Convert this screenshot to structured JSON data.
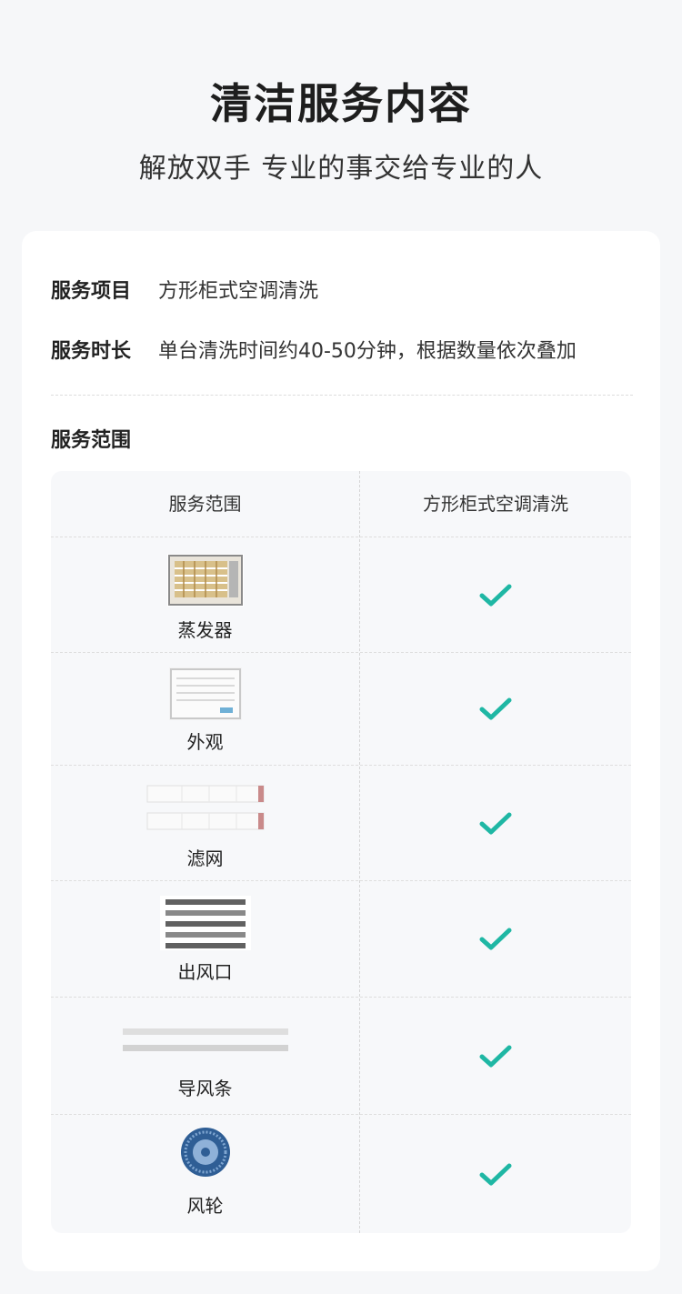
{
  "header": {
    "title": "清洁服务内容",
    "subtitle": "解放双手 专业的事交给专业的人"
  },
  "info": {
    "service_item_key": "服务项目",
    "service_item_value": "方形柜式空调清洗",
    "duration_key": "服务时长",
    "duration_value": "单台清洗时间约40-50分钟，根据数量依次叠加"
  },
  "scope": {
    "section_label": "服务范围",
    "col_left": "服务范围",
    "col_right": "方形柜式空调清洗",
    "rows": [
      {
        "label": "蒸发器",
        "icon": "evaporator-image",
        "included": true
      },
      {
        "label": "外观",
        "icon": "cabinet-exterior-image",
        "included": true
      },
      {
        "label": "滤网",
        "icon": "filter-image",
        "included": true
      },
      {
        "label": "出风口",
        "icon": "air-outlet-image",
        "included": true
      },
      {
        "label": "导风条",
        "icon": "louver-strip-image",
        "included": true
      },
      {
        "label": "风轮",
        "icon": "fan-wheel-image",
        "included": true
      }
    ]
  },
  "colors": {
    "check": "#1fb7a4",
    "card_bg": "#ffffff",
    "page_bg": "#f6f7f9"
  }
}
